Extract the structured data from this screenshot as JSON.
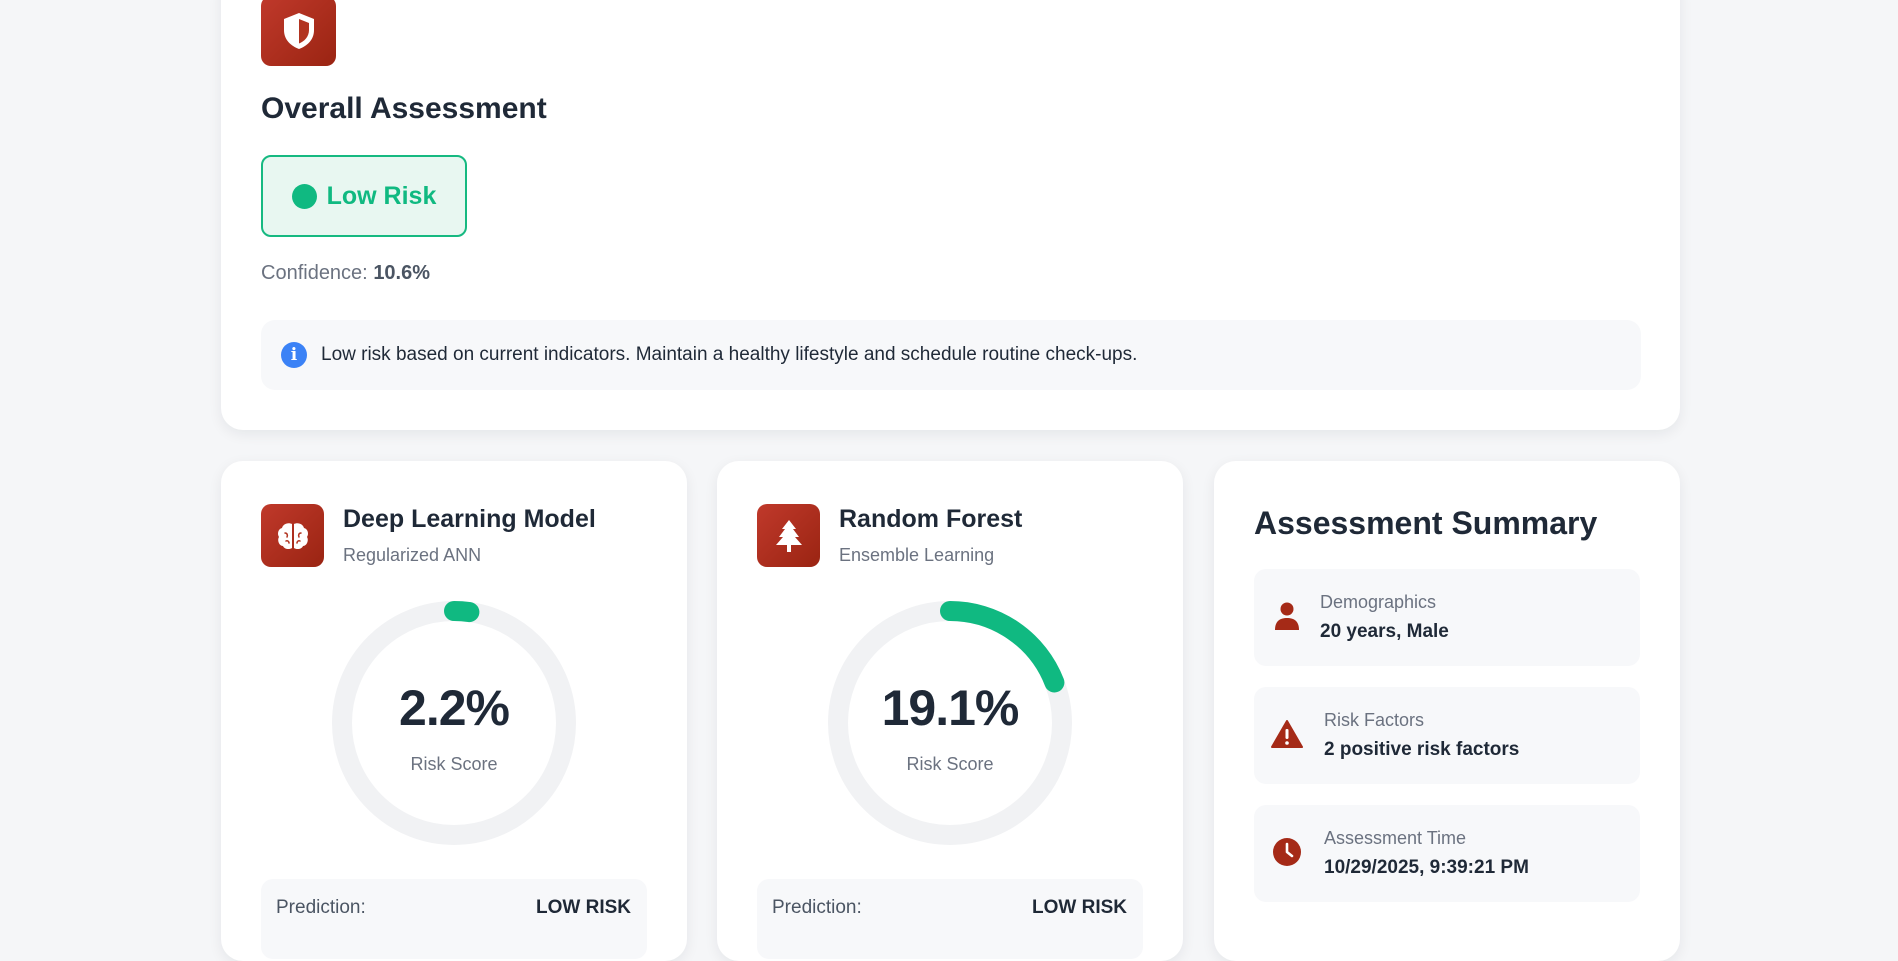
{
  "overall": {
    "title": "Overall Assessment",
    "risk_label": "Low Risk",
    "confidence_label": "Confidence:",
    "confidence_value": "10.6%",
    "info_text": "Low risk based on current indicators. Maintain a healthy lifestyle and schedule routine check-ups.",
    "risk_color": "#10b981"
  },
  "models": [
    {
      "title": "Deep Learning Model",
      "subtitle": "Regularized ANN",
      "icon": "brain-icon",
      "score_text": "2.2%",
      "score": 2.2,
      "score_label": "Risk Score",
      "prediction_label": "Prediction:",
      "prediction_value": "LOW RISK"
    },
    {
      "title": "Random Forest",
      "subtitle": "Ensemble Learning",
      "icon": "tree-icon",
      "score_text": "19.1%",
      "score": 19.1,
      "score_label": "Risk Score",
      "prediction_label": "Prediction:",
      "prediction_value": "LOW RISK"
    }
  ],
  "summary": {
    "title": "Assessment Summary",
    "items": [
      {
        "label": "Demographics",
        "value": "20 years, Male",
        "icon": "person-icon"
      },
      {
        "label": "Risk Factors",
        "value": "2 positive risk factors",
        "icon": "warning-icon"
      },
      {
        "label": "Assessment Time",
        "value": "10/29/2025, 9:39:21 PM",
        "icon": "clock-icon"
      }
    ]
  },
  "colors": {
    "accent": "#b52e1a",
    "success": "#10b981",
    "info": "#3b82f6",
    "track": "#f1f2f4"
  }
}
